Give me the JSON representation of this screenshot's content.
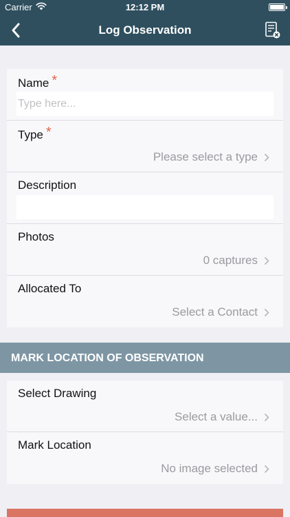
{
  "status_bar": {
    "carrier": "Carrier",
    "time": "12:12 PM"
  },
  "nav": {
    "title": "Log Observation"
  },
  "form": {
    "name": {
      "label": "Name",
      "required_mark": "*",
      "placeholder": "Type here..."
    },
    "type": {
      "label": "Type",
      "required_mark": "*",
      "value": "Please select a type"
    },
    "description": {
      "label": "Description"
    },
    "photos": {
      "label": "Photos",
      "value": "0 captures"
    },
    "allocated_to": {
      "label": "Allocated To",
      "value": "Select a Contact"
    }
  },
  "location_section": {
    "header": "MARK LOCATION OF OBSERVATION",
    "select_drawing": {
      "label": "Select Drawing",
      "value": "Select a value..."
    },
    "mark_location": {
      "label": "Mark Location",
      "value": "No image selected"
    }
  },
  "colors": {
    "nav_background": "#2f4f5f",
    "section_header": "#7e96a4",
    "required_accent": "#e0674d",
    "submit_bar": "#d97562"
  }
}
